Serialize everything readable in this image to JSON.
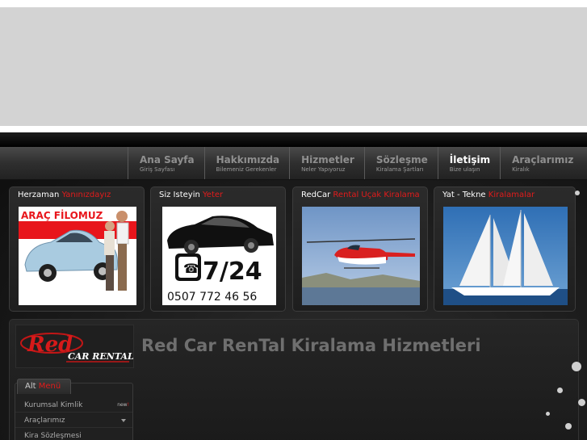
{
  "nav": {
    "items": [
      {
        "title": "Ana Sayfa",
        "sub": "Giriş Sayfası",
        "active": false
      },
      {
        "title": "Hakkımızda",
        "sub": "Bilemeniz Gerekenler",
        "active": false
      },
      {
        "title": "Hizmetler",
        "sub": "Neler Yapıyoruz",
        "active": false
      },
      {
        "title": "Sözleşme",
        "sub": "Kiralama Şartları",
        "active": false
      },
      {
        "title": "İletişim",
        "sub": "Bize ulaşın",
        "active": true
      },
      {
        "title": "Araçlarımız",
        "sub": "Kiralık",
        "active": false
      }
    ]
  },
  "boxes": [
    {
      "title_white": "Herzaman",
      "title_red": "Yanınızdayız",
      "image_text": "ARAÇ FİLOMUZ"
    },
    {
      "title_white": "Siz Isteyin",
      "title_red": "Yeter",
      "image_big": "7/24",
      "image_phone": "0507 772 46 56"
    },
    {
      "title_white": "RedCar",
      "title_red": "Rental Uçak Kiralama"
    },
    {
      "title_white": "Yat - Tekne",
      "title_red": "Kiralamalar"
    }
  ],
  "logo": {
    "red_text": "Red",
    "white_text": "CAR RENTAL"
  },
  "headline": "Red Car RenTal Kiralama Hizmetleri",
  "menu": {
    "tab_white": "Alt",
    "tab_red": "Menü",
    "items": [
      {
        "label": "Kurumsal Kimlik",
        "badge_a": "new",
        "badge_b": "!"
      },
      {
        "label": "Araçlarımız"
      },
      {
        "label": "Kira Sözleşmesi"
      }
    ]
  },
  "colors": {
    "accent": "#e21b1b",
    "background": "#1a1a1a",
    "banner": "#d3d3d3"
  }
}
